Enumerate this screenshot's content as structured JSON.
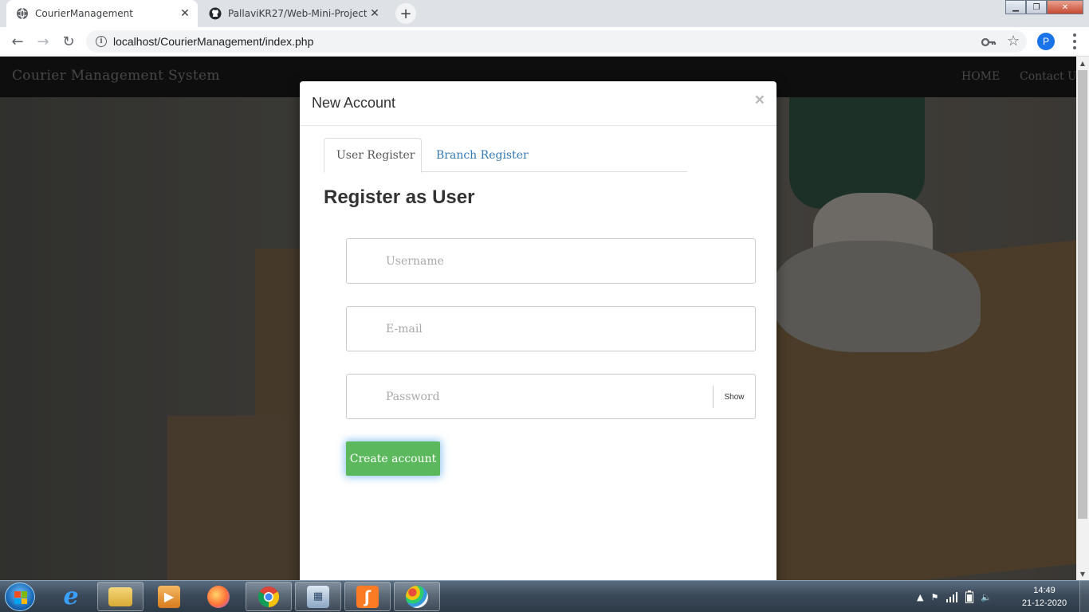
{
  "browser": {
    "tabs": [
      {
        "title": "CourierManagement",
        "active": true
      },
      {
        "title": "PallaviKR27/Web-Mini-Project",
        "active": false
      }
    ],
    "url": "localhost/CourierManagement/index.php",
    "profile_initial": "P"
  },
  "site": {
    "brand": "Courier Management System",
    "nav": [
      "HOME",
      "Contact Us"
    ]
  },
  "modal": {
    "title": "New Account",
    "close_glyph": "×",
    "tabs": [
      "User Register",
      "Branch Register"
    ],
    "heading": "Register as User",
    "fields": {
      "username_placeholder": "Username",
      "email_placeholder": "E-mail",
      "password_placeholder": "Password",
      "show_label": "Show"
    },
    "submit_label": "Create account"
  },
  "taskbar": {
    "apps": [
      "internet-explorer",
      "windows-explorer",
      "media-player",
      "firefox",
      "chrome",
      "remote-desktop",
      "xampp",
      "paint"
    ],
    "time": "14:49",
    "date": "21-12-2020"
  },
  "colors": {
    "primary_link": "#337ab7",
    "success": "#5cb85c",
    "navbar": "#161616"
  }
}
